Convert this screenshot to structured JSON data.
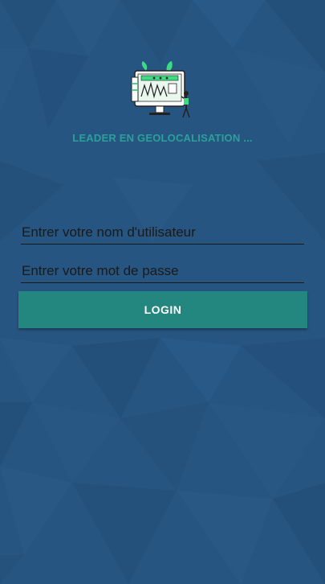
{
  "app": {
    "tagline": "LEADER EN GEOLOCALISATION ..."
  },
  "logo": {
    "icon": "monitor-dashboard-illustration-icon"
  },
  "form": {
    "username_placeholder": "Entrer votre nom d'utilisateur",
    "username_value": "",
    "password_placeholder": "Entrer votre mot de passe",
    "password_value": "",
    "login_label": "LOGIN"
  },
  "colors": {
    "background": "#275581",
    "accent": "#23867f",
    "tagline": "#2aa198"
  }
}
